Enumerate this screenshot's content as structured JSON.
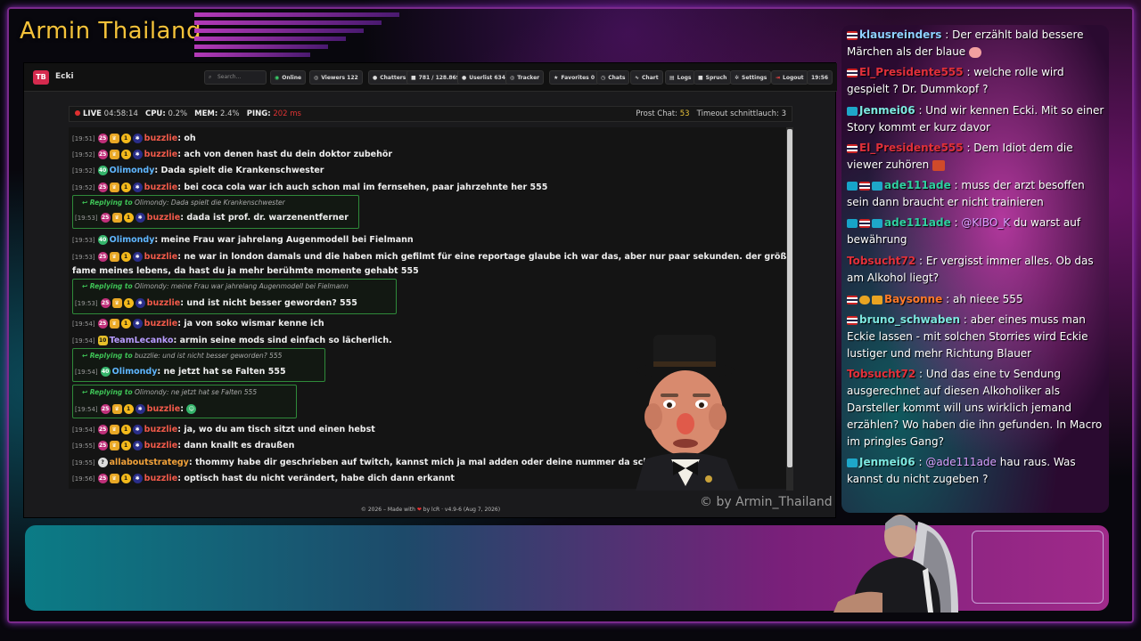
{
  "channel_title": "Armin Thailand",
  "watermark": "© by Armin_Thailand",
  "app": {
    "logo": "TB",
    "brand": "Ecki",
    "search_placeholder": "Search...",
    "nav": [
      {
        "label": "Online",
        "icon": "wifi-icon"
      },
      {
        "label": "Viewers 122",
        "icon": "eye-icon"
      },
      {
        "label": "Chatters 5",
        "icon": "users-icon"
      },
      {
        "label": "781 / 128.869",
        "icon": "chat-icon"
      },
      {
        "label": "Userlist 634",
        "icon": "user-icon"
      },
      {
        "label": "Tracker",
        "icon": "target-icon"
      },
      {
        "label": "Favorites 0",
        "icon": "star-icon"
      },
      {
        "label": "Chats",
        "icon": "history-icon"
      },
      {
        "label": "Chart",
        "icon": "chart-icon"
      },
      {
        "label": "Logs",
        "icon": "file-icon"
      },
      {
        "label": "Spruch",
        "icon": "quote-icon"
      },
      {
        "label": "Settings",
        "icon": "gear-icon"
      },
      {
        "label": "Logout",
        "icon": "logout-icon"
      },
      {
        "label": "19:56",
        "icon": ""
      }
    ],
    "status": {
      "live_label": "LIVE",
      "uptime": "04:58:14",
      "cpu_label": "CPU:",
      "cpu": "0.2%",
      "mem_label": "MEM:",
      "mem": "2.4%",
      "ping_label": "PING:",
      "ping": "202 ms",
      "prost_label": "Prost Chat:",
      "prost": "53",
      "timeout_label": "Timeout schnittlauch:",
      "timeout": "3"
    },
    "footer": {
      "pre": "© 2026 – Made with",
      "heart": "❤",
      "post": "by lcR · v4.9-6 (Aug 7, 2026)"
    },
    "reply_prefix": "Replying to",
    "messages": [
      {
        "ts": "[19:51]",
        "user": "buzzlie",
        "text": "oh"
      },
      {
        "ts": "[19:52]",
        "user": "buzzlie",
        "text": "ach von denen hast du dein doktor zubehör"
      },
      {
        "ts": "[19:52]",
        "user": "Olimondy",
        "text": "Dada spielt die Krankenschwester"
      },
      {
        "ts": "[19:52]",
        "user": "buzzlie",
        "text": "bei coca cola war ich auch schon mal im fernsehen, paar jahrzehnte her 555"
      },
      {
        "reply": "Olimondy: Dada spielt die Krankenschwester",
        "ts": "[19:53]",
        "user": "buzzlie",
        "text": "dada ist prof. dr. warzenentferner"
      },
      {
        "ts": "[19:53]",
        "user": "Olimondy",
        "text": "meine Frau war jahrelang Augenmodell bei Fielmann"
      },
      {
        "ts": "[19:53]",
        "user": "buzzlie",
        "text": "ne war in london damals und die haben mich gefilmt für eine reportage glaube ich war das, aber nur paar sekunden. der größte",
        "cont": "fame meines lebens, da hast du ja mehr berühmte momente gehabt 555"
      },
      {
        "reply": "Olimondy: meine Frau war jahrelang Augenmodell bei Fielmann",
        "ts": "[19:53]",
        "user": "buzzlie",
        "text": "und ist nicht besser geworden? 555"
      },
      {
        "ts": "[19:54]",
        "user": "buzzlie",
        "text": "ja von soko wismar kenne ich"
      },
      {
        "ts": "[19:54]",
        "user": "TeamLecanko",
        "badge": "10",
        "text": "armin seine mods sind einfach so lächerlich."
      },
      {
        "reply": "buzzlie: und ist nicht besser geworden? 555",
        "ts": "[19:54]",
        "user": "Olimondy",
        "text": "ne jetzt hat se Falten 555"
      },
      {
        "reply": "Olimondy: ne jetzt hat se Falten 555",
        "ts": "[19:54]",
        "user": "buzzlie",
        "text": ""
      },
      {
        "ts": "[19:54]",
        "user": "buzzlie",
        "text": "ja, wo du am tisch sitzt und einen hebst"
      },
      {
        "ts": "[19:55]",
        "user": "buzzlie",
        "text": "dann knallt es draußen"
      },
      {
        "ts": "[19:55]",
        "user": "allaboutstrategy",
        "text": "thommy habe dir geschrieben auf twitch, kannst mich ja mal adden oder deine nummer da schreiben"
      },
      {
        "ts": "[19:56]",
        "user": "buzzlie",
        "text": "optisch hast du nicht verändert, habe dich dann erkannt"
      }
    ]
  },
  "side_chat": [
    {
      "user": "klausreinders",
      "text": ": Der erzählt bald bessere Märchen als der blaue"
    },
    {
      "user": "El_Presidente555",
      "text": ": welche rolle wird gespielt ? Dr. Dummkopf ?"
    },
    {
      "user": "Jenmei06",
      "text": ": Und wir kennen Ecki. Mit so einer Story kommt er kurz davor"
    },
    {
      "user": "El_Presidente555",
      "text": ": Dem Idiot dem die viewer zuhören"
    },
    {
      "user": "ade111ade",
      "text": ": muss der arzt besoffen sein dann braucht er nicht trainieren"
    },
    {
      "user": "ade111ade",
      "text": ":",
      "mention": "@KIBO_K",
      "after": " du warst auf bewährung"
    },
    {
      "user": "Tobsucht72",
      "text": ": Er vergisst immer alles. Ob das am Alkohol liegt?"
    },
    {
      "user": "Baysonne",
      "text": ": ah nieee 555"
    },
    {
      "user": "bruno_schwaben",
      "text": ": aber eines muss man Eckie lassen - mit solchen Storries wird Eckie lustiger und mehr Richtung Blauer"
    },
    {
      "user": "Tobsucht72",
      "text": ": Und das eine tv Sendung ausgerechnet auf diesen Alkoholiker als Darsteller kommt will uns wirklich jemand erzählen? Wo haben die ihn gefunden. In Macro im pringles Gang?"
    },
    {
      "user": "Jenmei06",
      "text": ":",
      "mention": "@ade111ade",
      "after": " hau raus. Was kannst du nicht zugeben ?"
    }
  ]
}
